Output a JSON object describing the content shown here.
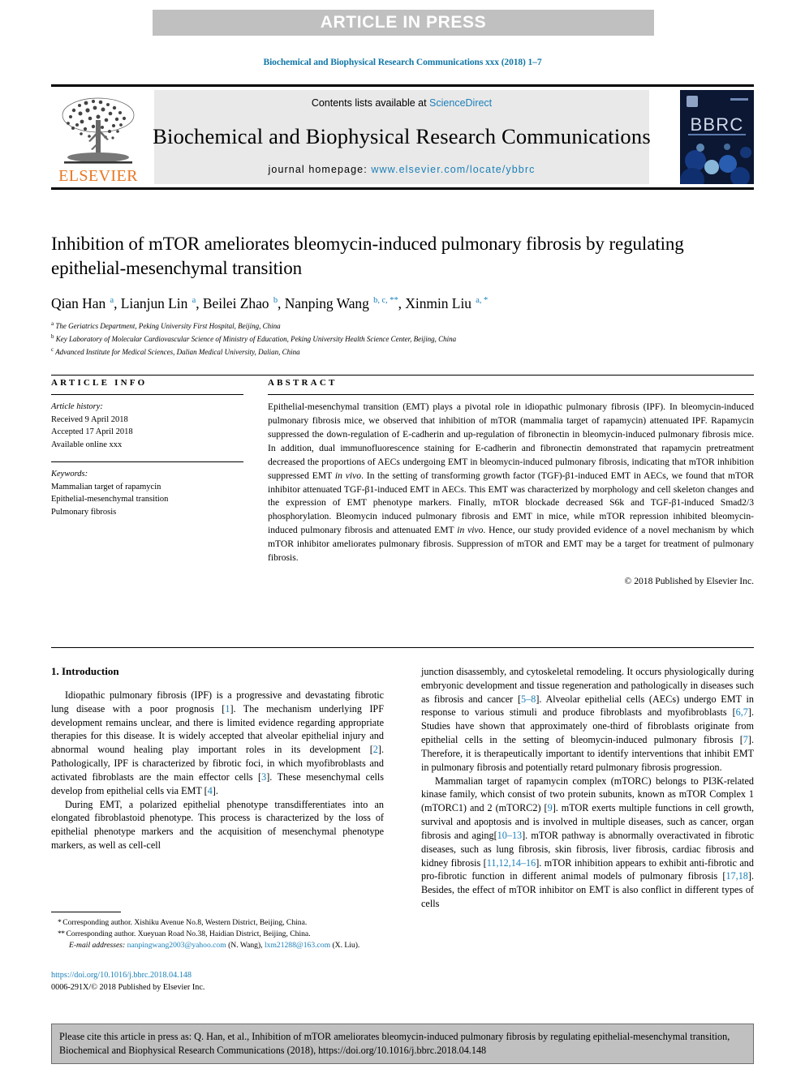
{
  "banner": {
    "text": "ARTICLE IN PRESS"
  },
  "running_head": "Biochemical and Biophysical Research Communications xxx (2018) 1–7",
  "masthead": {
    "contents_prefix": "Contents lists available at ",
    "contents_link": "ScienceDirect",
    "journal_title": "Biochemical and Biophysical Research Communications",
    "homepage_prefix": "journal homepage: ",
    "homepage_url": "www.elsevier.com/locate/ybbrc",
    "publisher": "ELSEVIER",
    "cover_label": "BBRC"
  },
  "article": {
    "title": "Inhibition of mTOR ameliorates bleomycin-induced pulmonary fibrosis by regulating epithelial-mesenchymal transition",
    "authors_html": "Qian Han <sup>a</sup>, Lianjun Lin <sup>a</sup>, Beilei Zhao <sup>b</sup>, Nanping Wang <sup>b, c, **</sup>, Xinmin Liu <sup>a, *</sup>",
    "affiliations": [
      {
        "marker": "a",
        "text": "The Geriatrics Department, Peking University First Hospital, Beijing, China"
      },
      {
        "marker": "b",
        "text": "Key Laboratory of Molecular Cardiovascular Science of Ministry of Education, Peking University Health Science Center, Beijing, China"
      },
      {
        "marker": "c",
        "text": "Advanced Institute for Medical Sciences, Dalian Medical University, Dalian, China"
      }
    ]
  },
  "article_info": {
    "heading": "ARTICLE INFO",
    "history_label": "Article history:",
    "history": [
      "Received 9 April 2018",
      "Accepted 17 April 2018",
      "Available online xxx"
    ],
    "keywords_label": "Keywords:",
    "keywords": [
      "Mammalian target of rapamycin",
      "Epithelial-mesenchymal transition",
      "Pulmonary fibrosis"
    ]
  },
  "abstract": {
    "heading": "ABSTRACT",
    "text": "Epithelial-mesenchymal transition (EMT) plays a pivotal role in idiopathic pulmonary fibrosis (IPF). In bleomycin-induced pulmonary fibrosis mice, we observed that inhibition of mTOR (mammalia target of rapamycin) attenuated IPF. Rapamycin suppressed the down-regulation of E-cadherin and up-regulation of fibronectin in bleomycin-induced pulmonary fibrosis mice. In addition, dual immunofluorescence staining for E-cadherin and fibronectin demonstrated that rapamycin pretreatment decreased the proportions of AECs undergoing EMT in bleomycin-induced pulmonary fibrosis, indicating that mTOR inhibition suppressed EMT in vivo. In the setting of transforming growth factor (TGF)-β1-induced EMT in AECs, we found that mTOR inhibitor attenuated TGF-β1-induced EMT in AECs. This EMT was characterized by morphology and cell skeleton changes and the expression of EMT phenotype markers. Finally, mTOR blockade decreased S6k and TGF-β1-induced Smad2/3 phosphorylation. Bleomycin induced pulmonary fibrosis and EMT in mice, while mTOR repression inhibited bleomycin-induced pulmonary fibrosis and attenuated EMT in vivo. Hence, our study provided evidence of a novel mechanism by which mTOR inhibitor ameliorates pulmonary fibrosis. Suppression of mTOR and EMT may be a target for treatment of pulmonary fibrosis.",
    "copyright": "© 2018 Published by Elsevier Inc."
  },
  "introduction": {
    "heading": "1.  Introduction",
    "left_paragraphs": [
      "Idiopathic pulmonary fibrosis (IPF) is a progressive and devastating fibrotic lung disease with a poor prognosis [1]. The mechanism underlying IPF development remains unclear, and there is limited evidence regarding appropriate therapies for this disease. It is widely accepted that alveolar epithelial injury and abnormal wound healing play important roles in its development [2]. Pathologically, IPF is characterized by fibrotic foci, in which myofibroblasts and activated fibroblasts are the main effector cells [3]. These mesenchymal cells develop from epithelial cells via EMT [4].",
      "During EMT, a polarized epithelial phenotype transdifferentiates into an elongated fibroblastoid phenotype. This process is characterized by the loss of epithelial phenotype markers and the acquisition of mesenchymal phenotype markers, as well as cell-cell"
    ],
    "right_paragraphs": [
      "junction disassembly, and cytoskeletal remodeling. It occurs physiologically during embryonic development and tissue regeneration and pathologically in diseases such as fibrosis and cancer [5–8]. Alveolar epithelial cells (AECs) undergo EMT in response to various stimuli and produce fibroblasts and myofibroblasts [6,7]. Studies have shown that approximately one-third of fibroblasts originate from epithelial cells in the setting of bleomycin-induced pulmonary fibrosis [7]. Therefore, it is therapeutically important to identify interventions that inhibit EMT in pulmonary fibrosis and potentially retard pulmonary fibrosis progression.",
      "Mammalian target of rapamycin complex (mTORC) belongs to PI3K-related kinase family, which consist of two protein subunits, known as mTOR Complex 1 (mTORC1) and 2 (mTORC2) [9]. mTOR exerts multiple functions in cell growth, survival and apoptosis and is involved in multiple diseases, such as cancer, organ fibrosis and aging[10–13]. mTOR pathway is abnormally overactivated in fibrotic diseases, such as lung fibrosis, skin fibrosis, liver fibrosis, cardiac fibrosis and kidney fibrosis [11,12,14–16]. mTOR inhibition appears to exhibit anti-fibrotic and pro-fibrotic function in different animal models of pulmonary fibrosis [17,18]. Besides, the effect of mTOR inhibitor on EMT is also conflict in different types of cells"
    ]
  },
  "footnotes": {
    "corresponding_1": "Corresponding author. Xishiku Avenue No.8, Western District, Beijing, China.",
    "corresponding_2": "Corresponding author. Xueyuan Road No.38, Haidian District, Beijing, China.",
    "email_label": "E-mail addresses:",
    "email_1": "nanpingwang2003@yahoo.com",
    "email_1_who": "(N. Wang),",
    "email_2": "lxm21288@163.com",
    "email_2_who": "(X. Liu).",
    "doi": "https://doi.org/10.1016/j.bbrc.2018.04.148",
    "issn_line": "0006-291X/© 2018 Published by Elsevier Inc."
  },
  "cite_box": {
    "text": "Please cite this article in press as: Q. Han, et al., Inhibition of mTOR ameliorates bleomycin-induced pulmonary fibrosis by regulating epithelial-mesenchymal transition, Biochemical and Biophysical Research Communications (2018), https://doi.org/10.1016/j.bbrc.2018.04.148"
  },
  "colors": {
    "link": "#1a7fb8",
    "banner_bg": "#c0c0c0",
    "elsevier_orange": "#e87722",
    "masthead_bg": "#e9e9e9"
  }
}
